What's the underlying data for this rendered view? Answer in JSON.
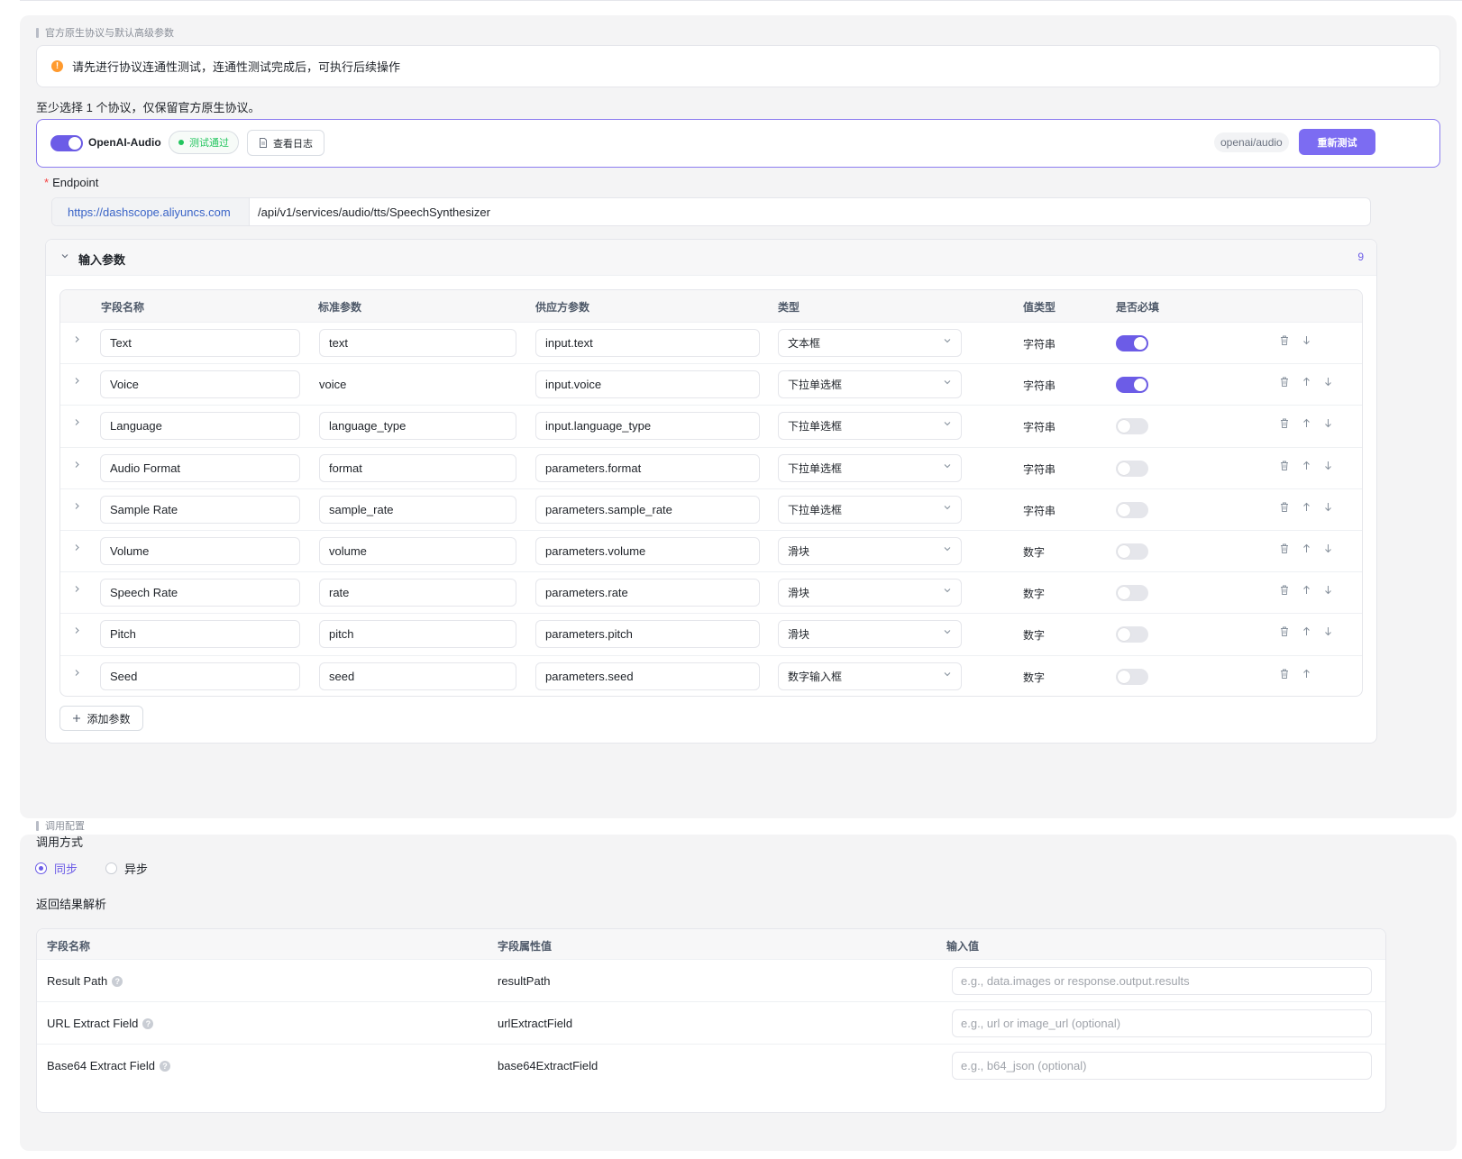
{
  "section1": {
    "title": "官方原生协议与默认高级参数",
    "alert": "请先进行协议连通性测试，连通性测试完成后，可执行后续操作",
    "hint": "至少选择 1 个协议，仅保留官方原生协议。",
    "protocol": {
      "name": "OpenAI-Audio",
      "enabled": true,
      "status": "测试通过",
      "log_button": "查看日志",
      "path_tag": "openai/audio",
      "retest_button": "重新测试"
    },
    "endpoint": {
      "label": "Endpoint",
      "required_mark": "*",
      "prefix": "https://dashscope.aliyuncs.com",
      "path": "/api/v1/services/audio/tts/SpeechSynthesizer"
    },
    "params": {
      "title": "输入参数",
      "count": "9",
      "headers": {
        "field_name": "字段名称",
        "standard": "标准参数",
        "vendor": "供应方参数",
        "type": "类型",
        "value_type": "值类型",
        "required": "是否必填"
      },
      "rows": [
        {
          "field": "Text",
          "standard": "text",
          "vendor": "input.text",
          "type": "文本框",
          "value_type": "字符串",
          "required": true
        },
        {
          "field": "Voice",
          "standard": "voice",
          "vendor": "input.voice",
          "type": "下拉单选框",
          "value_type": "字符串",
          "required": true
        },
        {
          "field": "Language",
          "standard": "language_type",
          "vendor": "input.language_type",
          "type": "下拉单选框",
          "value_type": "字符串",
          "required": false
        },
        {
          "field": "Audio Format",
          "standard": "format",
          "vendor": "parameters.format",
          "type": "下拉单选框",
          "value_type": "字符串",
          "required": false
        },
        {
          "field": "Sample Rate",
          "standard": "sample_rate",
          "vendor": "parameters.sample_rate",
          "type": "下拉单选框",
          "value_type": "字符串",
          "required": false
        },
        {
          "field": "Volume",
          "standard": "volume",
          "vendor": "parameters.volume",
          "type": "滑块",
          "value_type": "数字",
          "required": false
        },
        {
          "field": "Speech Rate",
          "standard": "rate",
          "vendor": "parameters.rate",
          "type": "滑块",
          "value_type": "数字",
          "required": false
        },
        {
          "field": "Pitch",
          "standard": "pitch",
          "vendor": "parameters.pitch",
          "type": "滑块",
          "value_type": "数字",
          "required": false
        },
        {
          "field": "Seed",
          "standard": "seed",
          "vendor": "parameters.seed",
          "type": "数字输入框",
          "value_type": "数字",
          "required": false
        }
      ],
      "add_button": "添加参数"
    }
  },
  "section2": {
    "title": "调用配置",
    "mode_label": "调用方式",
    "modes": [
      {
        "label": "同步",
        "selected": true
      },
      {
        "label": "异步",
        "selected": false
      }
    ],
    "parse_label": "返回结果解析",
    "headers": {
      "field_name": "字段名称",
      "attr": "字段属性值",
      "input": "输入值"
    },
    "rows": [
      {
        "name": "Result Path",
        "attr": "resultPath",
        "placeholder": "e.g., data.images or response.output.results"
      },
      {
        "name": "URL Extract Field",
        "attr": "urlExtractField",
        "placeholder": "e.g., url or image_url (optional)"
      },
      {
        "name": "Base64 Extract Field",
        "attr": "base64ExtractField",
        "placeholder": "e.g., b64_json (optional)"
      }
    ]
  },
  "icons": {
    "warning": "warning-icon",
    "log": "document-icon",
    "collapse": "chevron-down-icon",
    "expand": "chevron-right-icon",
    "select_arrow": "chevron-down-icon",
    "delete": "trash-icon",
    "move_up": "arrow-up-icon",
    "move_down": "arrow-down-icon",
    "add": "plus-icon",
    "help": "question-icon"
  },
  "colors": {
    "accent": "#6c5ce7",
    "success": "#22c55e",
    "warning": "#ff9a2e",
    "link": "#3a64c7"
  }
}
